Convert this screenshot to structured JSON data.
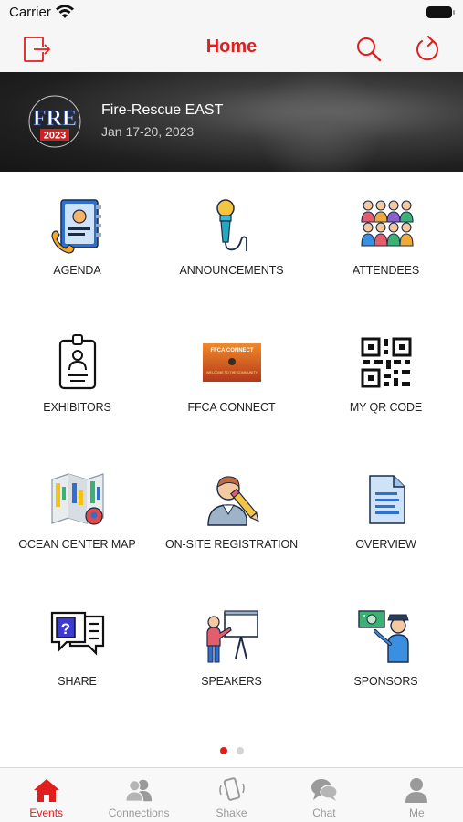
{
  "status_bar": {
    "carrier": "Carrier"
  },
  "navbar": {
    "title": "Home",
    "accent_color": "#e01e1e",
    "left_icon": "logout-icon",
    "right_icons": [
      "search-icon",
      "refresh-icon"
    ]
  },
  "banner": {
    "logo_text": "FRE",
    "logo_year": "2023",
    "title": "Fire-Rescue EAST",
    "dates": "Jan 17-20, 2023"
  },
  "tiles": [
    {
      "label": "AGENDA",
      "icon": "agenda-icon"
    },
    {
      "label": "ANNOUNCEMENTS",
      "icon": "microphone-icon"
    },
    {
      "label": "ATTENDEES",
      "icon": "attendees-icon"
    },
    {
      "label": "EXHIBITORS",
      "icon": "badge-icon"
    },
    {
      "label": "FFCA CONNECT",
      "icon": "ffca-connect-thumbnail"
    },
    {
      "label": "MY QR CODE",
      "icon": "qr-code-icon"
    },
    {
      "label": "OCEAN CENTER MAP",
      "icon": "map-icon"
    },
    {
      "label": "ON-SITE REGISTRATION",
      "icon": "registration-icon"
    },
    {
      "label": "OVERVIEW",
      "icon": "document-icon"
    },
    {
      "label": "SHARE",
      "icon": "chat-question-icon"
    },
    {
      "label": "SPEAKERS",
      "icon": "presentation-icon"
    },
    {
      "label": "SPONSORS",
      "icon": "sponsor-icon"
    }
  ],
  "ffca_thumbnail_text": {
    "line1": "FFCA CONNECT",
    "line2": "WELCOME TO THE COMMUNITY"
  },
  "pager": {
    "pages": 2,
    "current": 1
  },
  "tabbar": [
    {
      "label": "Events",
      "icon": "events-icon",
      "active": true
    },
    {
      "label": "Connections",
      "icon": "connections-icon",
      "active": false
    },
    {
      "label": "Shake",
      "icon": "shake-icon",
      "active": false
    },
    {
      "label": "Chat",
      "icon": "chat-icon",
      "active": false
    },
    {
      "label": "Me",
      "icon": "me-icon",
      "active": false
    }
  ]
}
